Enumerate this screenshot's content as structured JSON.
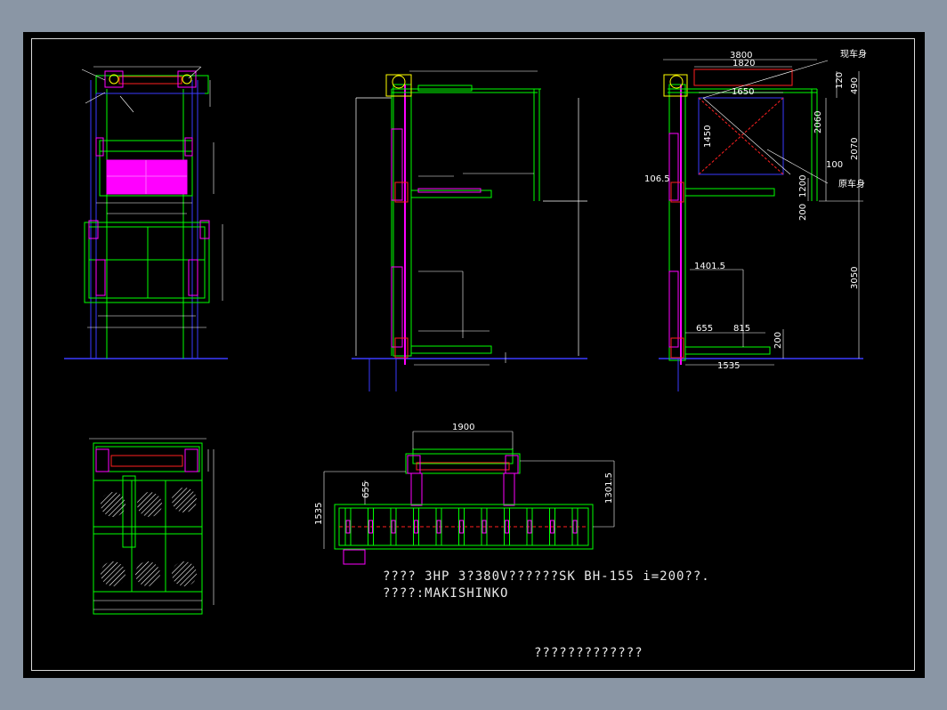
{
  "notes": {
    "motor_line": "???? 3HP 3?380V??????SK BH-155 i=200??.",
    "maker_line": "????:MAKISHINKO",
    "title_block": "?????????????"
  },
  "side_right": {
    "dims": {
      "d3800": "3800",
      "d1820": "1820",
      "d1650": "1650",
      "d1450": "1450",
      "d120": "120",
      "d490": "490",
      "d2060": "2060",
      "d2070": "2070",
      "d100": "100",
      "d106_5": "106.5",
      "d200": "200",
      "d1200": "1200",
      "d3050": "3050",
      "d1401_5": "1401.5",
      "d655": "655",
      "d815": "815",
      "d200b": "200",
      "d1535": "1535"
    },
    "label_top": "现车身",
    "label_bottom": "原车身"
  },
  "plan_bottom": {
    "dims": {
      "d1900": "1900",
      "d1535": "1535",
      "d655": "655",
      "d1301_5": "1301.5"
    }
  },
  "colors": {
    "green": "#00ff00",
    "magenta": "#ff00ff",
    "blue": "#3a3aff",
    "red": "#ff2020",
    "white": "#ffffff",
    "cyan": "#00ffff",
    "yellow": "#ffff00"
  },
  "icons": [
    "hatched-circle-icon",
    "sprocket-icon"
  ]
}
